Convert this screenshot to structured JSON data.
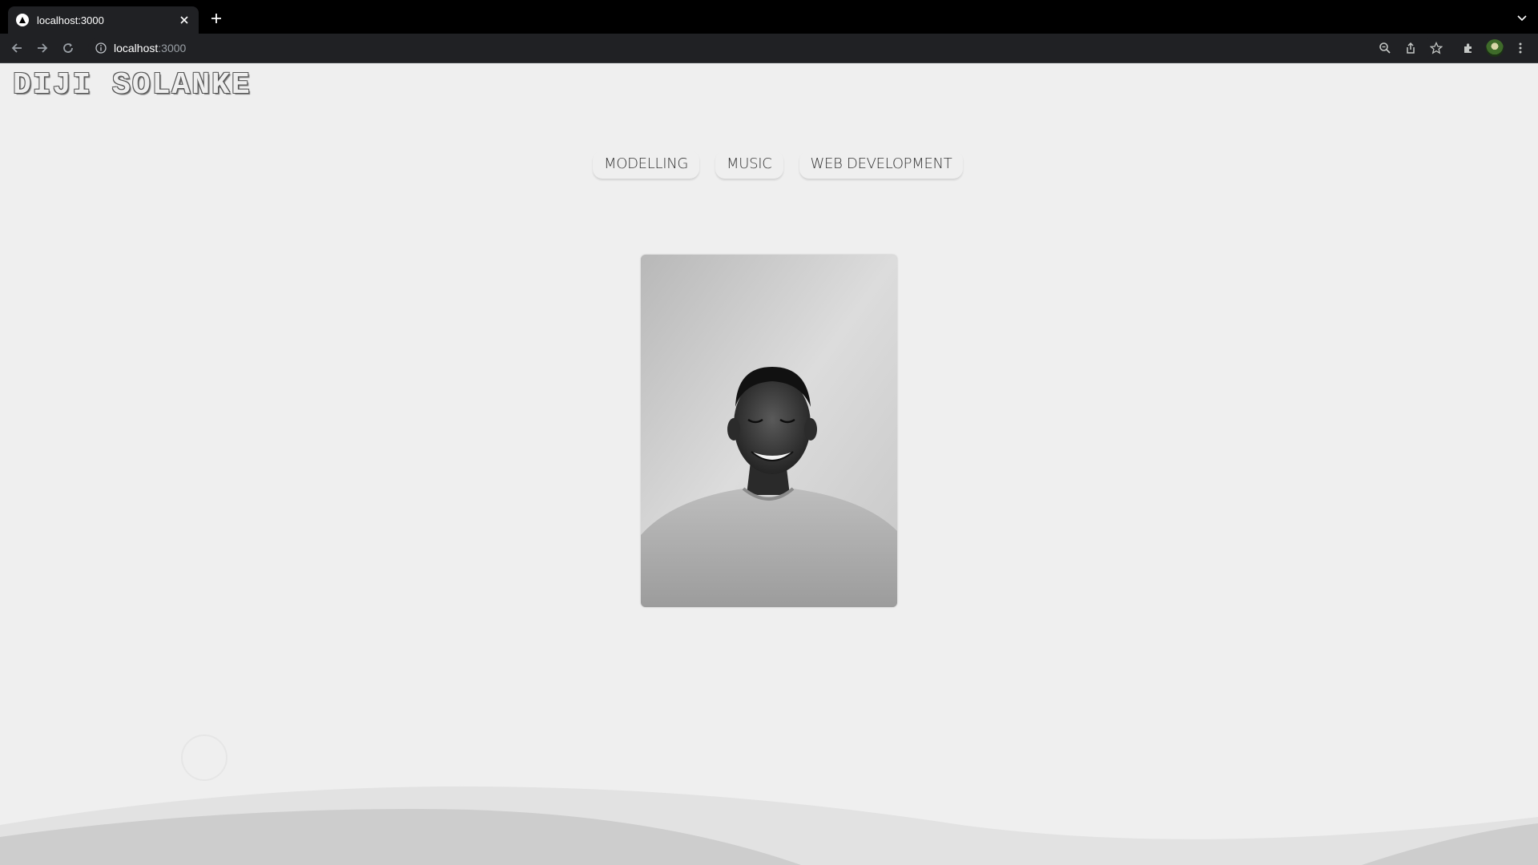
{
  "browser": {
    "tab_title": "localhost:3000",
    "url_host": "localhost",
    "url_rest": ":3000",
    "icons": [
      "favicon-triangle-icon",
      "close-icon",
      "plus-icon",
      "chevron-down-icon",
      "back-arrow-icon",
      "forward-arrow-icon",
      "reload-icon",
      "info-icon",
      "zoom-icon",
      "share-icon",
      "star-icon",
      "extensions-icon",
      "profile-avatar",
      "kebab-menu-icon"
    ]
  },
  "site": {
    "title": "DIJI SOLANKE",
    "nav": [
      {
        "label": "MODELLING"
      },
      {
        "label": "MUSIC"
      },
      {
        "label": "WEB DEVELOPMENT"
      }
    ]
  },
  "colors": {
    "page_background": "#efefef",
    "chrome_dark": "#202124",
    "tabbar": "#000000"
  }
}
